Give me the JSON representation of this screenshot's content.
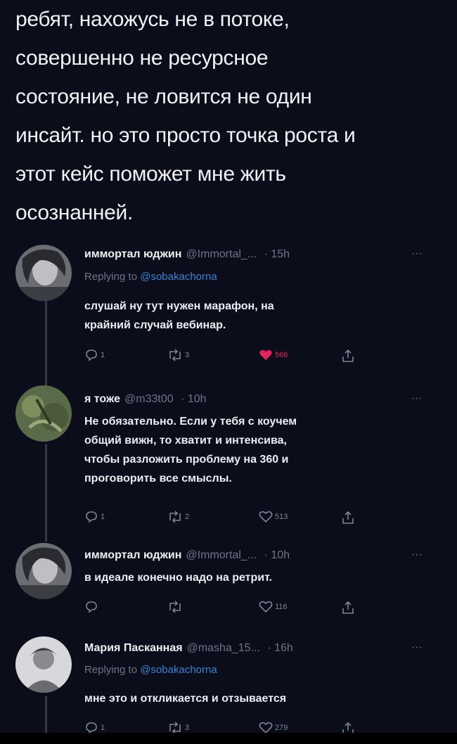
{
  "post": {
    "lines": [
      "ребят, нахожусь не в потоке,",
      "совершенно не ресурсное",
      "состояние, не ловится не один",
      "инсайт. но это просто точка роста и",
      "этот кейс поможет мне жить",
      "осознанней."
    ]
  },
  "tweets": [
    {
      "name": "иммортал юджин",
      "handle": "@Immortal_...",
      "time": "· 15h",
      "more": "···",
      "reply_prefix": "Replying to ",
      "reply_handle": "@sobakachorna",
      "lines": [
        "слушай ну тут нужен марафон, на",
        "крайний случай вебинар."
      ],
      "reply_count": "1",
      "retweet_count": "3",
      "like_count": "566"
    },
    {
      "name": "я тоже",
      "handle": "@m33t00",
      "time": "· 10h",
      "more": "···",
      "lines": [
        "Не обязательно. Если у тебя с коучем",
        "общий вижн, то хватит и интенсива,",
        "чтобы разложить проблему на 360 и",
        "проговорить все смыслы."
      ],
      "reply_count": "1",
      "retweet_count": "2",
      "like_count": "513"
    },
    {
      "name": "иммортал юджин",
      "handle": "@Immortal_...",
      "time": "· 10h",
      "more": "···",
      "lines": [
        "в идеале конечно надо на ретрит."
      ],
      "reply_count": "",
      "retweet_count": "",
      "like_count": "116"
    },
    {
      "name": "Мария Пасканная",
      "handle": "@masha_15...",
      "time": "· 16h",
      "more": "···",
      "reply_prefix": "Replying to ",
      "reply_handle": "@sobakachorna",
      "lines": [
        "мне это и откликается и отзывается"
      ],
      "reply_count": "1",
      "retweet_count": "3",
      "like_count": "279"
    }
  ],
  "colors": {
    "background": "#0b0d1a",
    "link": "#3a84d6",
    "like_active": "#e0245e",
    "muted": "#6f7485"
  }
}
